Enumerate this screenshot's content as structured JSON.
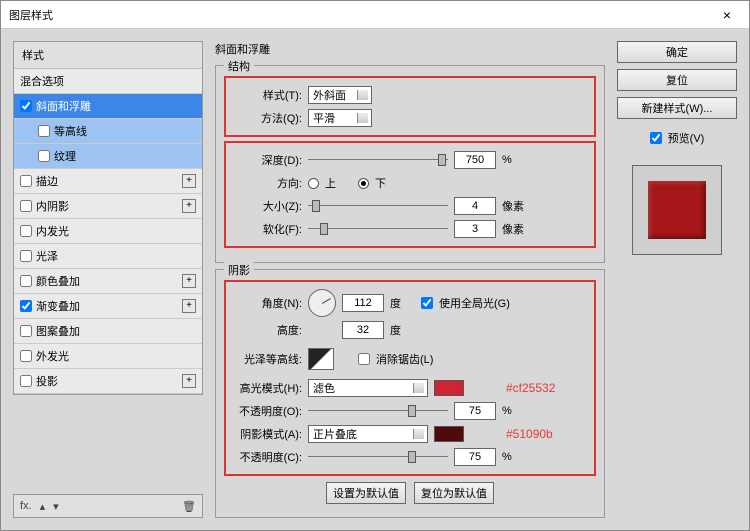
{
  "window": {
    "title": "图层样式",
    "close": "×"
  },
  "styles": {
    "header": "样式",
    "blend": "混合选项",
    "items": [
      {
        "label": "斜面和浮雕",
        "checked": true,
        "selected": true,
        "expandable": false,
        "level": 1
      },
      {
        "label": "等高线",
        "checked": false,
        "sub": true,
        "level": 2
      },
      {
        "label": "纹理",
        "checked": false,
        "sub": true,
        "level": 2
      },
      {
        "label": "描边",
        "checked": false,
        "expandable": true,
        "level": 1
      },
      {
        "label": "内阴影",
        "checked": false,
        "expandable": true,
        "level": 1
      },
      {
        "label": "内发光",
        "checked": false,
        "level": 1
      },
      {
        "label": "光泽",
        "checked": false,
        "level": 1
      },
      {
        "label": "颜色叠加",
        "checked": false,
        "expandable": true,
        "level": 1
      },
      {
        "label": "渐变叠加",
        "checked": true,
        "expandable": true,
        "level": 1
      },
      {
        "label": "图案叠加",
        "checked": false,
        "level": 1
      },
      {
        "label": "外发光",
        "checked": false,
        "level": 1
      },
      {
        "label": "投影",
        "checked": false,
        "expandable": true,
        "level": 1
      }
    ],
    "footer_fx": "fx."
  },
  "panel": {
    "title": "斜面和浮雕",
    "struct": {
      "title": "结构",
      "style_label": "样式(T):",
      "style_value": "外斜面",
      "method_label": "方法(Q):",
      "method_value": "平滑",
      "depth_label": "深度(D):",
      "depth_value": "750",
      "depth_unit": "%",
      "dir_label": "方向:",
      "dir_up": "上",
      "dir_down": "下",
      "size_label": "大小(Z):",
      "size_value": "4",
      "size_unit": "像素",
      "soften_label": "软化(F):",
      "soften_value": "3",
      "soften_unit": "像素"
    },
    "shadow": {
      "title": "阴影",
      "angle_label": "角度(N):",
      "angle_value": "112",
      "angle_unit": "度",
      "global_label": "使用全局光(G)",
      "global_checked": true,
      "alt_label": "高度:",
      "alt_value": "32",
      "alt_unit": "度",
      "gloss_label": "光泽等高线:",
      "aa_label": "消除锯齿(L)",
      "aa_checked": false,
      "hi_mode_label": "高光模式(H):",
      "hi_mode_value": "滤色",
      "hi_color": "#cf2533",
      "hi_op_label": "不透明度(O):",
      "hi_op_value": "75",
      "hi_op_unit": "%",
      "sh_mode_label": "阴影模式(A):",
      "sh_mode_value": "正片叠底",
      "sh_color": "#51090b",
      "sh_op_label": "不透明度(C):",
      "sh_op_value": "75",
      "sh_op_unit": "%"
    },
    "buttons": {
      "default": "设置为默认值",
      "reset": "复位为默认值"
    },
    "annot": {
      "hi": "#cf25532",
      "sh": "#51090b"
    }
  },
  "right": {
    "ok": "确定",
    "cancel": "复位",
    "newstyle": "新建样式(W)...",
    "preview_label": "预览(V)",
    "preview_checked": true
  }
}
